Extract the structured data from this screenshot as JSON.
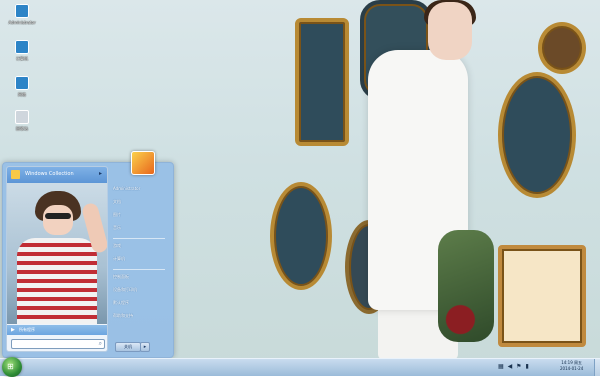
{
  "desktop": {
    "icons": [
      {
        "label": "Administrator",
        "icon": "user-folder-icon"
      },
      {
        "label": "计算机",
        "icon": "computer-icon"
      },
      {
        "label": "网络",
        "icon": "network-icon"
      },
      {
        "label": "回收站",
        "icon": "recycle-bin-icon"
      }
    ]
  },
  "start_menu": {
    "user_name": "Windows Collection",
    "all_programs": "所有程序",
    "search_placeholder": "搜索程序和文件",
    "right_items": [
      "Administrator",
      "文档",
      "图片",
      "音乐",
      "游戏",
      "计算机",
      "控制面板",
      "设备和打印机",
      "默认程序",
      "帮助和支持"
    ],
    "shutdown_label": "关机"
  },
  "taskbar": {
    "clock_time": "14:19 周五",
    "clock_date": "2014-01-24",
    "tray_icons": [
      "network-icon",
      "volume-icon",
      "flag-icon",
      "battery-icon"
    ]
  },
  "colors": {
    "accent": "#6ca5e0",
    "taskbar": "#9bbbd9"
  }
}
